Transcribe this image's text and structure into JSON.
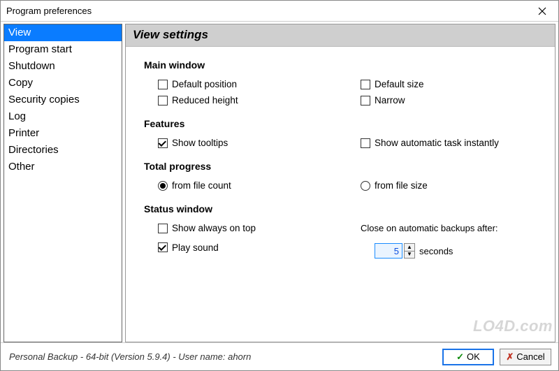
{
  "window": {
    "title": "Program preferences"
  },
  "sidebar": {
    "items": [
      {
        "label": "View",
        "selected": true
      },
      {
        "label": "Program start"
      },
      {
        "label": "Shutdown"
      },
      {
        "label": "Copy"
      },
      {
        "label": "Security copies"
      },
      {
        "label": "Log"
      },
      {
        "label": "Printer"
      },
      {
        "label": "Directories"
      },
      {
        "label": "Other"
      }
    ]
  },
  "panel": {
    "heading": "View settings",
    "groups": {
      "main_window": {
        "title": "Main window",
        "default_position": "Default position",
        "default_size": "Default size",
        "reduced_height": "Reduced height",
        "narrow": "Narrow"
      },
      "features": {
        "title": "Features",
        "show_tooltips": "Show tooltips",
        "show_auto_task": "Show automatic task instantly"
      },
      "total_progress": {
        "title": "Total progress",
        "from_file_count": "from file count",
        "from_file_size": "from file size"
      },
      "status_window": {
        "title": "Status window",
        "always_on_top": "Show always on top",
        "play_sound": "Play sound",
        "close_label": "Close on automatic backups after:",
        "seconds_value": "5",
        "seconds_unit": "seconds"
      }
    }
  },
  "footer": {
    "status": "Personal Backup - 64-bit (Version 5.9.4) - User name: ahorn",
    "ok": "OK",
    "cancel": "Cancel"
  },
  "watermark": "LO4D.com"
}
